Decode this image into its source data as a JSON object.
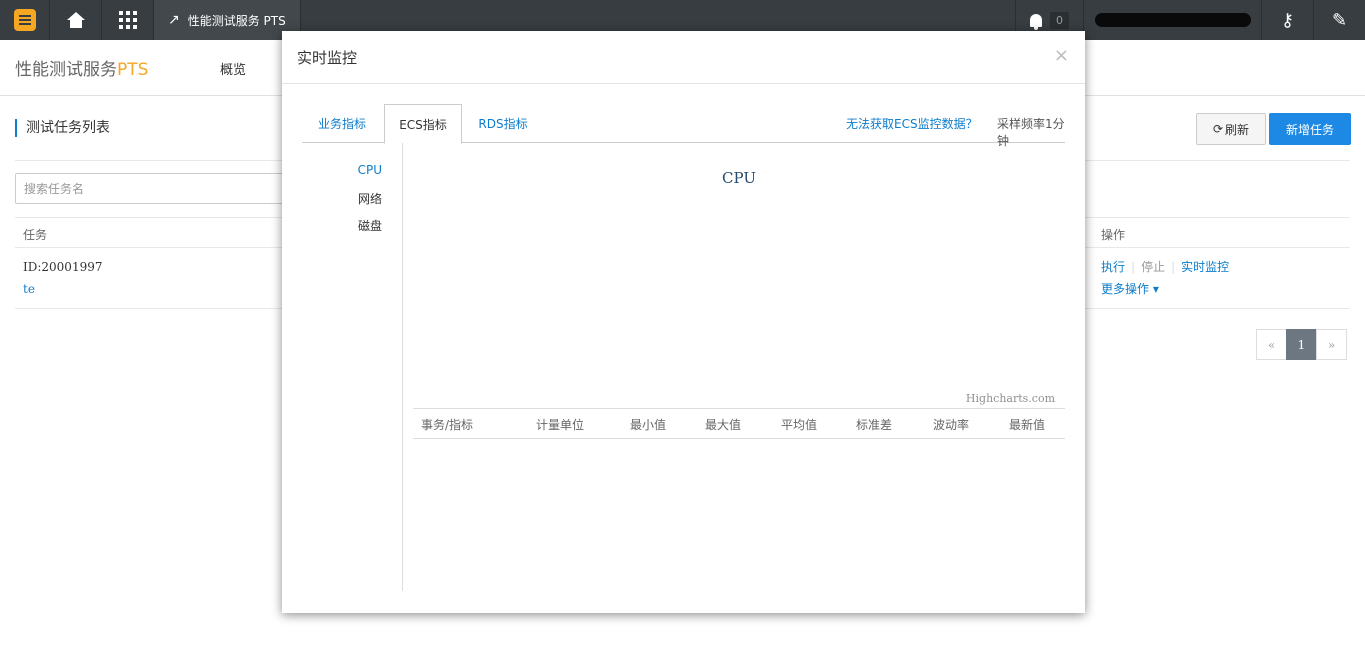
{
  "topbar": {
    "product": "性能测试服务 PTS",
    "notifications": "0"
  },
  "subheader": {
    "brand_main": "性能测试服务",
    "brand_accent": "PTS",
    "nav_overview": "概览"
  },
  "main": {
    "section_title": "测试任务列表",
    "refresh_label": "刷新",
    "new_task_label": "新增任务",
    "search_placeholder": "搜索任务名",
    "columns": {
      "task": "任务",
      "ops": "操作"
    },
    "row": {
      "id": "ID:20001997",
      "name": "te",
      "ops": {
        "run": "执行",
        "stop": "停止",
        "monitor": "实时监控",
        "more": "更多操作"
      }
    },
    "pager": {
      "prev": "«",
      "page": "1",
      "next": "»"
    }
  },
  "modal": {
    "title": "实时监控",
    "close": "×",
    "tabs": [
      "业务指标",
      "ECS指标",
      "RDS指标"
    ],
    "help_link": "无法获取ECS监控数据？",
    "frequency": "采样频率1分钟",
    "side_items": [
      "CPU",
      "网络",
      "磁盘"
    ],
    "chart_title": "CPU",
    "credit": "Highcharts.com",
    "table_columns": [
      "事务/指标",
      "计量单位",
      "最小值",
      "最大值",
      "平均值",
      "标准差",
      "波动率",
      "最新值"
    ]
  },
  "colors": {
    "accent": "#f5a623",
    "link": "#0d7dcc",
    "primary": "#1e88e5",
    "topbar": "#373d41"
  }
}
